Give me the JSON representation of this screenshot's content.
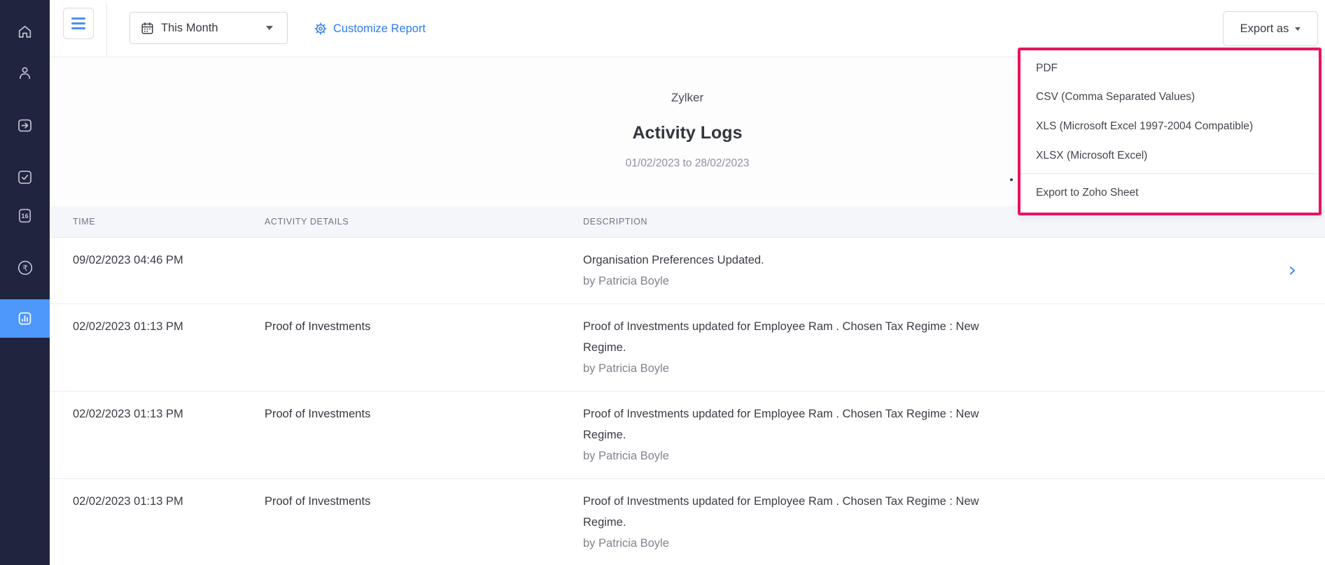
{
  "sidebar": {
    "items": [
      {
        "name": "home",
        "icon": "home-icon"
      },
      {
        "name": "employees",
        "icon": "employees-icon"
      },
      {
        "name": "pay-runs",
        "icon": "pay-runs-icon"
      },
      {
        "name": "approvals",
        "icon": "approvals-icon"
      },
      {
        "name": "form-16",
        "icon": "form16-icon",
        "badge": "16"
      },
      {
        "name": "taxes",
        "icon": "rupee-circle-icon",
        "glyph": "₹"
      },
      {
        "name": "reports",
        "icon": "bar-chart-icon",
        "active": true
      }
    ]
  },
  "toolbar": {
    "period_selector": {
      "value": "This Month"
    },
    "customize_report_label": "Customize Report",
    "export_button_label": "Export as"
  },
  "export_menu": {
    "items": [
      "PDF",
      "CSV (Comma Separated Values)",
      "XLS (Microsoft Excel 1997-2004 Compatible)",
      "XLSX (Microsoft Excel)"
    ],
    "footer_item": "Export to Zoho Sheet",
    "highlight_color": "#e8135e"
  },
  "report": {
    "org_name": "Zylker",
    "title": "Activity Logs",
    "date_range": "01/02/2023 to 28/02/2023"
  },
  "table": {
    "columns": [
      "TIME",
      "ACTIVITY DETAILS",
      "DESCRIPTION"
    ],
    "rows": [
      {
        "time": "09/02/2023 04:46 PM",
        "activity": "",
        "description": "Organisation Preferences Updated.",
        "by": "by Patricia Boyle"
      },
      {
        "time": "02/02/2023 01:13 PM",
        "activity": "Proof of Investments",
        "description": "Proof of Investments updated for Employee Ram . Chosen Tax Regime : New Regime.",
        "by": "by Patricia Boyle"
      },
      {
        "time": "02/02/2023 01:13 PM",
        "activity": "Proof of Investments",
        "description": "Proof of Investments updated for Employee Ram . Chosen Tax Regime : New Regime.",
        "by": "by Patricia Boyle"
      },
      {
        "time": "02/02/2023 01:13 PM",
        "activity": "Proof of Investments",
        "description": "Proof of Investments updated for Employee Ram . Chosen Tax Regime : New Regime.",
        "by": "by Patricia Boyle"
      }
    ]
  },
  "colors": {
    "sidebar_bg": "#20243f",
    "sidebar_active_bg": "#4e97fb",
    "accent_blue": "#2e7bf5",
    "highlight_pink": "#e8135e",
    "table_header_bg": "#f4f6fa"
  }
}
